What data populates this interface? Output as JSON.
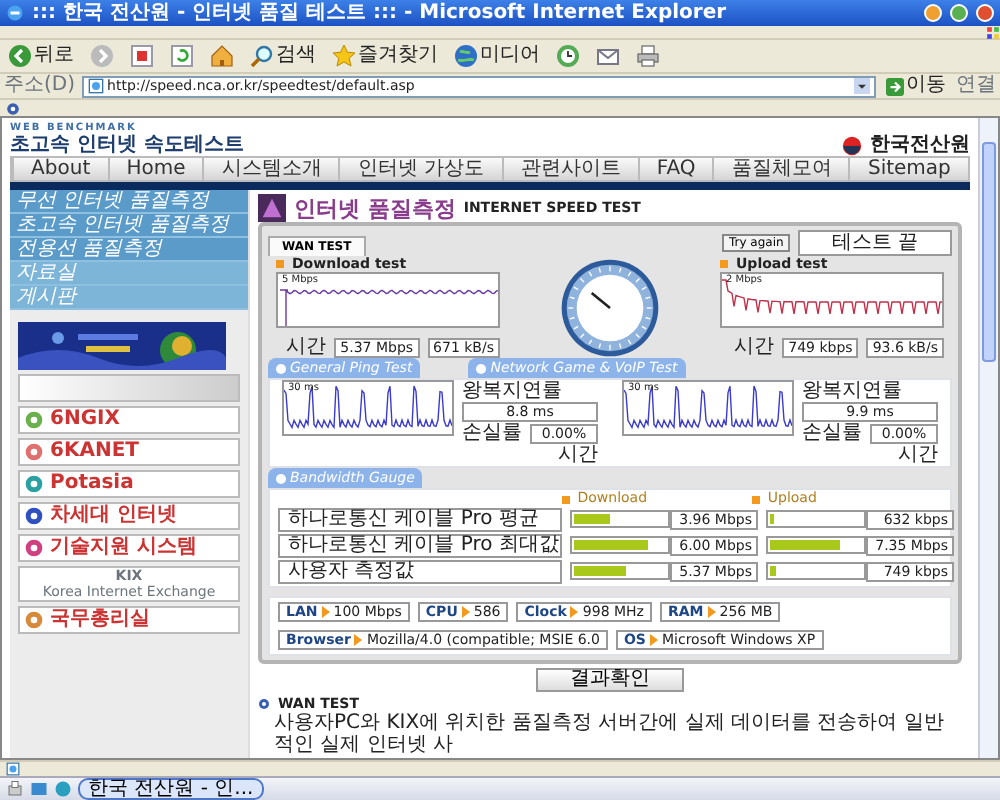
{
  "window": {
    "title": "::: 한국 전산원 - 인터넷 품질 테스트 ::: - Microsoft Internet Explorer"
  },
  "toolbar": [
    {
      "kind": "back",
      "label": "뒤로"
    },
    {
      "kind": "forward"
    },
    {
      "kind": "stop"
    },
    {
      "kind": "refresh"
    },
    {
      "kind": "home"
    },
    {
      "kind": "search",
      "label": "검색"
    },
    {
      "kind": "favorites",
      "label": "즐겨찾기"
    },
    {
      "kind": "media",
      "label": "미디어"
    },
    {
      "kind": "history"
    },
    {
      "kind": "mail"
    },
    {
      "kind": "print"
    }
  ],
  "address_bar": {
    "label": "주소(D)",
    "url": "http://speed.nca.or.kr/speedtest/default.asp",
    "go": "이동",
    "links": "연결"
  },
  "site": {
    "tagline": "WEB BENCHMARK",
    "title": "초고속 인터넷 속도테스트",
    "org": "한국전산원",
    "nav": [
      "About",
      "Home",
      "시스템소개",
      "인터넷 가상도",
      "관련사이트",
      "FAQ",
      "품질체모여",
      "Sitemap"
    ]
  },
  "sidebar": {
    "menu": [
      "무선 인터넷 품질측정",
      "초고속 인터넷 품질측정",
      "전용선 품질측정",
      "자료실",
      "게시판"
    ],
    "banners": [
      {
        "kind": "picture"
      },
      {
        "kind": "blank"
      },
      {
        "kind": "logo",
        "text": "6NGIX"
      },
      {
        "kind": "logo",
        "text": "6KANET"
      },
      {
        "kind": "logo",
        "text": "Potasia"
      },
      {
        "kind": "logo",
        "text": "차세대 인터넷"
      },
      {
        "kind": "logo",
        "text": "기술지원 시스템"
      },
      {
        "kind": "kix",
        "text": "KIX",
        "caption": "Korea Internet Exchange"
      },
      {
        "kind": "logo",
        "text": "국무총리실"
      }
    ]
  },
  "main": {
    "title": "인터넷 품질측정",
    "subtitle": "INTERNET SPEED TEST",
    "tabs": [
      {
        "label": "WAN TEST",
        "selected": true
      }
    ],
    "try_again": "Try again",
    "status": "테스트 끝",
    "download": {
      "label": "Download test",
      "scale": "5 Mbps",
      "axis": "시간",
      "readings": [
        "5.37 Mbps",
        "671 kB/s"
      ]
    },
    "upload": {
      "label": "Upload test",
      "scale": "2 Mbps",
      "axis": "시간",
      "readings": [
        "749 kbps",
        "93.6 kB/s"
      ]
    },
    "section_labels": [
      "General Ping Test",
      "Network Game & VoIP Test"
    ],
    "ping": [
      {
        "scale": "30 ms",
        "rtt_label": "왕복지연률",
        "rtt": "8.8 ms",
        "loss_label": "손실률",
        "loss": "0.00%",
        "axis": "시간"
      },
      {
        "scale": "30 ms",
        "rtt_label": "왕복지연률",
        "rtt": "9.9 ms",
        "loss_label": "손실률",
        "loss": "0.00%",
        "axis": "시간"
      }
    ],
    "bandwidth": {
      "title": "Bandwidth Gauge",
      "download_label": "Download",
      "upload_label": "Upload",
      "rows": [
        {
          "name": "하나로통신 케이블 Pro 평균",
          "download": {
            "level": 0.4,
            "reading": "3.96 Mbps"
          },
          "upload": {
            "level": 0.05,
            "reading": "632 kbps"
          }
        },
        {
          "name": "하나로통신 케이블 Pro 최대값",
          "download": {
            "level": 0.8,
            "reading": "6.00 Mbps"
          },
          "upload": {
            "level": 0.75,
            "reading": "7.35 Mbps"
          }
        },
        {
          "name": "사용자 측정값",
          "download": {
            "level": 0.57,
            "reading": "5.37 Mbps"
          },
          "upload": {
            "level": 0.06,
            "reading": "749 kbps"
          }
        }
      ]
    },
    "system": [
      {
        "label": "LAN",
        "value": "100 Mbps"
      },
      {
        "label": "CPU",
        "value": "586"
      },
      {
        "label": "Clock",
        "value": "998 MHz"
      },
      {
        "label": "RAM",
        "value": "256 MB"
      },
      {
        "label": "Browser",
        "value": "Mozilla/4.0 (compatible; MSIE 6.0"
      },
      {
        "label": "OS",
        "value": "Microsoft Windows XP"
      }
    ],
    "result_button": "결과확인",
    "about": {
      "heading": "WAN TEST",
      "text": "사용자PC와 KIX에 위치한 품질측정 서버간에 실제 데이터를 전송하여 일반적인 실제 인터넷 사"
    }
  },
  "taskbar": {
    "tasks": [
      "한국 전산원 - 인..."
    ]
  }
}
